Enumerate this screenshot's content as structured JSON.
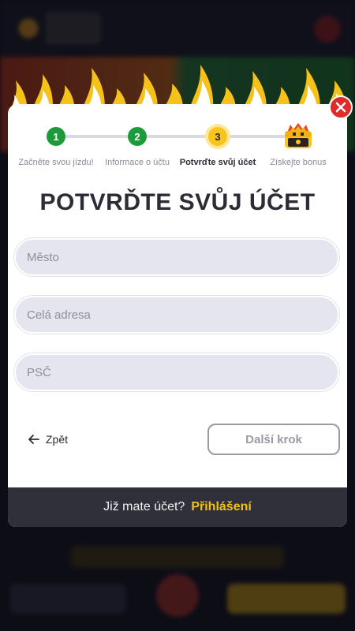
{
  "colors": {
    "accent_yellow": "#f7c51e",
    "step_done_green": "#1d9a3a",
    "close_red": "#e02b2b",
    "footer_bg": "#2f3039",
    "login_link": "#f2c01a"
  },
  "stepper": {
    "steps": [
      {
        "number": "1",
        "label": "Začněte svou jízdu!",
        "state": "done"
      },
      {
        "number": "2",
        "label": "Informace o účtu",
        "state": "done"
      },
      {
        "number": "3",
        "label": "Potvrďte svůj účet",
        "state": "active"
      },
      {
        "number": "",
        "label": "Získejte bonus",
        "state": "bonus",
        "icon": "treasure-chest-icon"
      }
    ]
  },
  "form": {
    "title": "POTVRĎTE SVŮJ ÚČET",
    "fields": [
      {
        "name": "city",
        "placeholder": "Město",
        "value": ""
      },
      {
        "name": "address",
        "placeholder": "Celá adresa",
        "value": ""
      },
      {
        "name": "zip",
        "placeholder": "PSČ",
        "value": ""
      }
    ]
  },
  "actions": {
    "back_label": "Zpět",
    "back_icon": "arrow-left-icon",
    "next_label": "Další krok"
  },
  "footer": {
    "question": "Již mate účet?",
    "login_label": "Přihlášení"
  },
  "close_icon": "close-icon"
}
